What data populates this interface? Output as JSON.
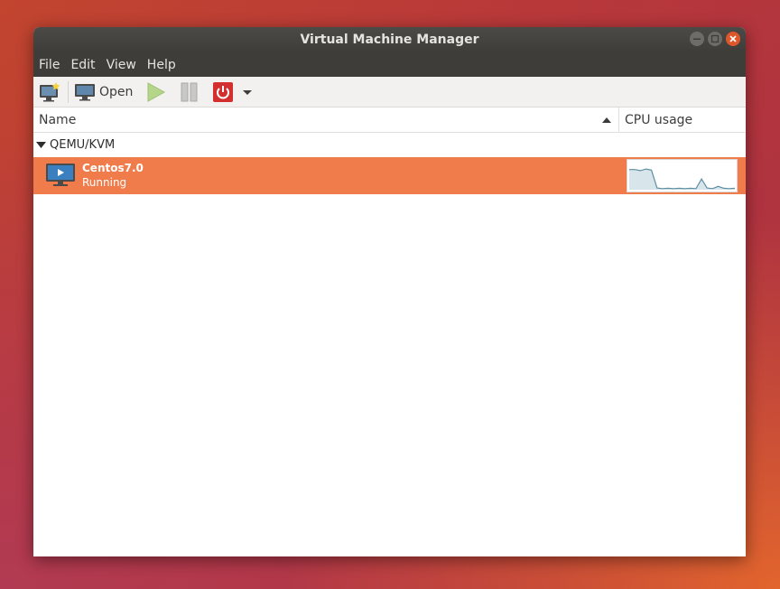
{
  "window": {
    "title": "Virtual Machine Manager"
  },
  "menubar": {
    "items": [
      "File",
      "Edit",
      "View",
      "Help"
    ]
  },
  "toolbar": {
    "new_vm_icon": "new-vm-icon",
    "open_label": "Open",
    "run_icon": "play-icon",
    "pause_icon": "pause-icon",
    "shutdown_icon": "power-icon",
    "dropdown_icon": "chevron-down-icon"
  },
  "list": {
    "columns": {
      "name": "Name",
      "cpu": "CPU usage"
    },
    "sort": "ascending",
    "groups": [
      {
        "label": "QEMU/KVM",
        "expanded": true,
        "vms": [
          {
            "name": "Centos7.0",
            "status": "Running",
            "selected": true,
            "cpu_history": [
              0.72,
              0.72,
              0.68,
              0.74,
              0.7,
              0.06,
              0.04,
              0.05,
              0.04,
              0.05,
              0.04,
              0.05,
              0.04,
              0.38,
              0.06,
              0.04,
              0.12,
              0.05,
              0.04,
              0.05
            ]
          }
        ]
      }
    ]
  },
  "colors": {
    "selection": "#f07c4c",
    "titlebar": "#3e3d39",
    "cpu_line": "#5d8fa3",
    "cpu_fill": "#d8e6ec",
    "close_button": "#e0562b"
  }
}
